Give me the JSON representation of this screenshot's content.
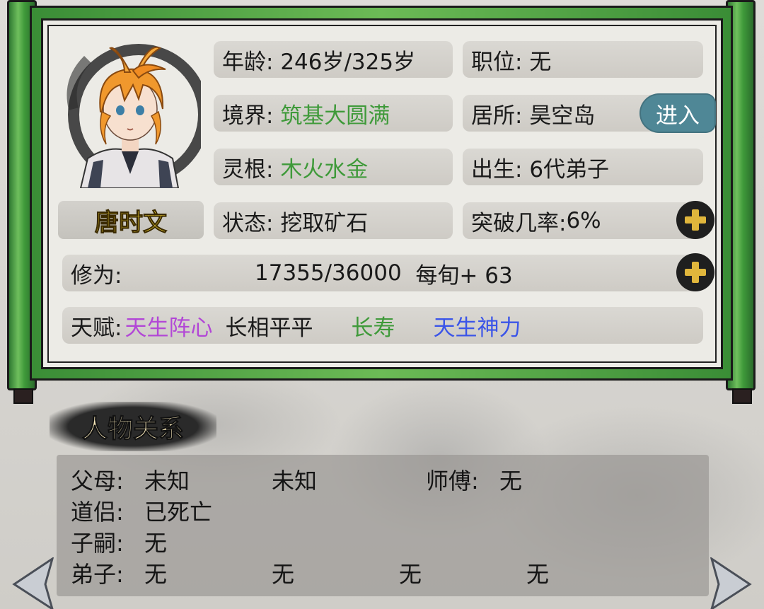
{
  "character": {
    "name": "唐时文",
    "age_label": "年龄:",
    "age_value": "246岁/325岁",
    "position_label": "职位:",
    "position_value": "无",
    "realm_label": "境界:",
    "realm_value": "筑基大圆满",
    "residence_label": "居所:",
    "residence_value": "昊空岛",
    "enter_label": "进入",
    "root_label": "灵根:",
    "root_value": "木火水金",
    "birth_label": "出生:",
    "birth_value": "6代弟子",
    "status_label": "状态:",
    "status_value": "挖取矿石",
    "breakthrough_label": "突破几率:",
    "breakthrough_value": "6%",
    "cultivation_label": "修为:",
    "cultivation_value": "17355/36000",
    "cultivation_rate": "每旬+ 63",
    "talent_label": "天赋:",
    "talents": [
      {
        "text": "天生阵心",
        "color": "purple"
      },
      {
        "text": "长相平平",
        "color": "black"
      },
      {
        "text": "长寿",
        "color": "green"
      },
      {
        "text": "天生神力",
        "color": "blue"
      }
    ]
  },
  "relations": {
    "title": "人物关系",
    "parents_label": "父母:",
    "parents": [
      "未知",
      "未知"
    ],
    "master_label": "师傅:",
    "master_value": "无",
    "partner_label": "道侣:",
    "partner_value": "已死亡",
    "children_label": "子嗣:",
    "children_value": "无",
    "disciples_label": "弟子:",
    "disciples": [
      "无",
      "无",
      "无",
      "无"
    ]
  },
  "colors": {
    "scroll_green": "#3f9a3a",
    "talent_purple": "#b247d6",
    "talent_green": "#3f9a3a",
    "talent_blue": "#3b55e8",
    "enter_button": "#4f8796",
    "name_yellow": "#f2d43a"
  },
  "icons": [
    "character-portrait",
    "plus-icon",
    "plus-icon",
    "left-arrow-icon",
    "right-arrow-icon"
  ]
}
